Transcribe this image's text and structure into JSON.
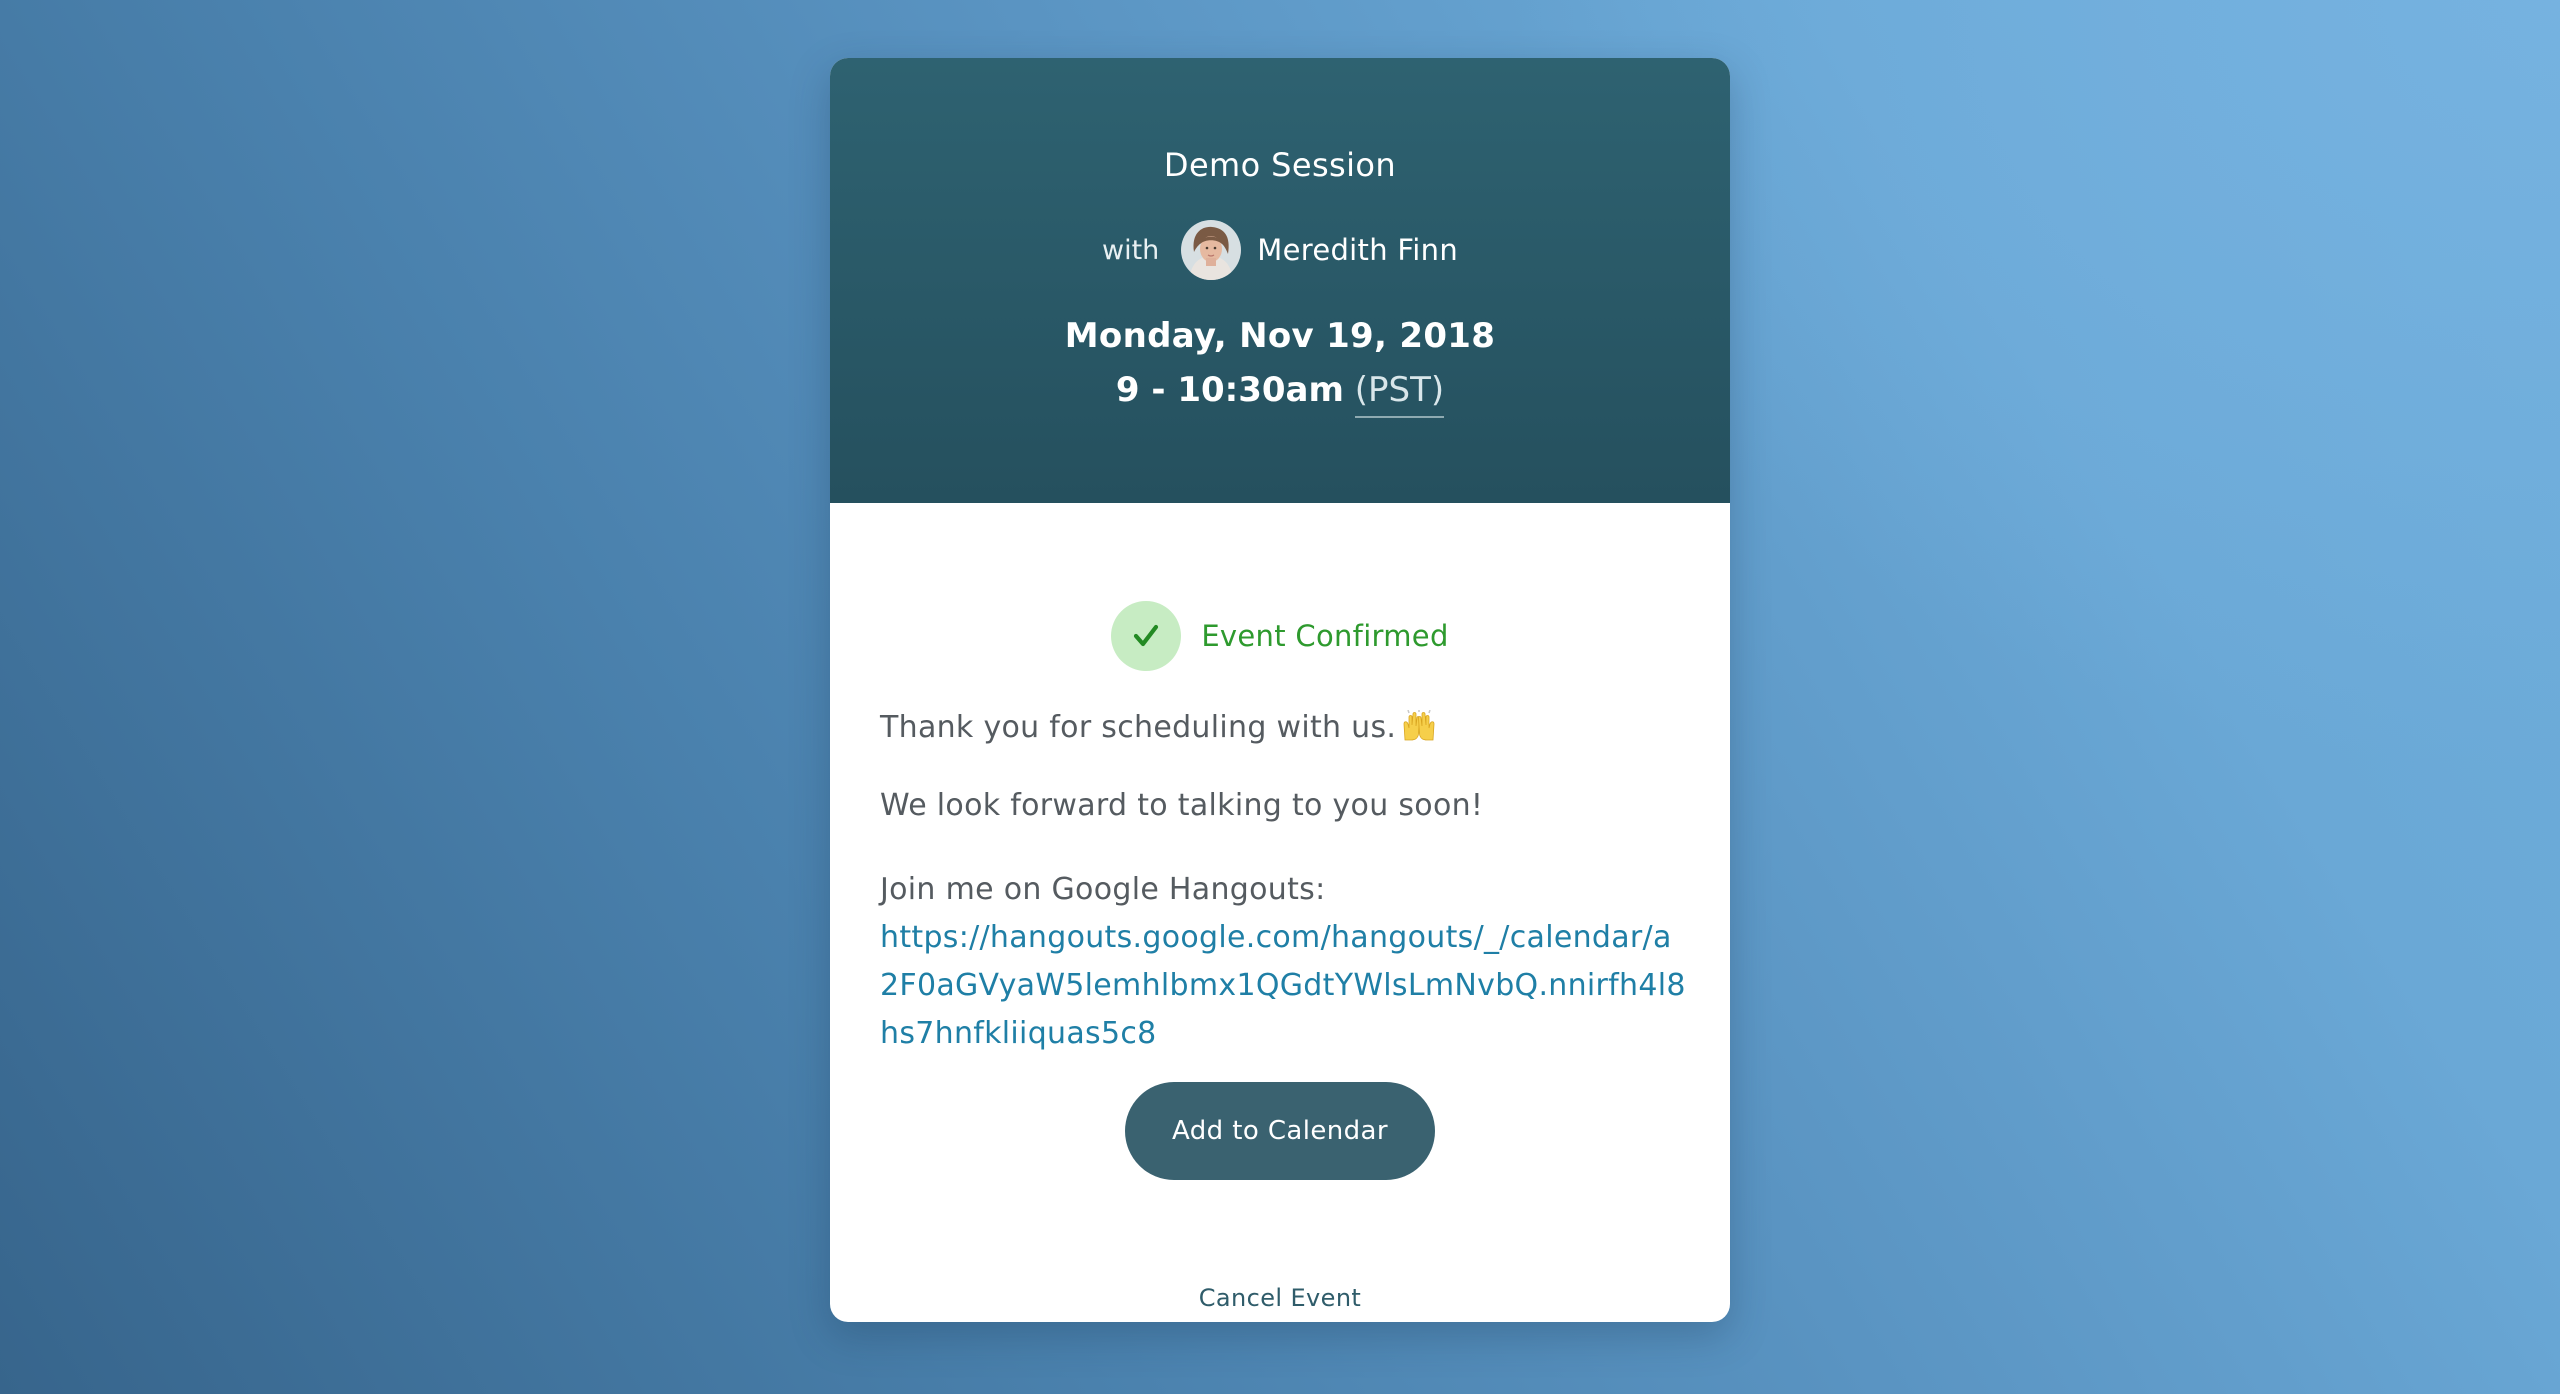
{
  "event": {
    "title": "Demo Session",
    "with_label": "with",
    "host_name": "Meredith Finn",
    "date": "Monday, Nov 19, 2018",
    "time": "9 - 10:30am",
    "timezone": "(PST)"
  },
  "status": {
    "text": "Event Confirmed",
    "icon": "check-icon",
    "color": "#2e9a2e"
  },
  "message": {
    "thanks": "Thank you for scheduling with us.",
    "thanks_emoji": "raised-hands-icon",
    "followup": "We look forward to talking to you soon!",
    "join_label": "Join me on Google Hangouts:",
    "join_url": "https://hangouts.google.com/hangouts/_/calendar/a2F0aGVyaW5lemhlbmx1QGdtYWlsLmNvbQ.nnirfh4l8hs7hnfkliiquas5c8"
  },
  "actions": {
    "add_to_calendar": "Add to Calendar",
    "cancel_event": "Cancel Event"
  },
  "colors": {
    "header": "#2b5a69",
    "button": "#3a6270",
    "link": "#1f7fa6",
    "confirm_bg": "#c7ecc3"
  }
}
